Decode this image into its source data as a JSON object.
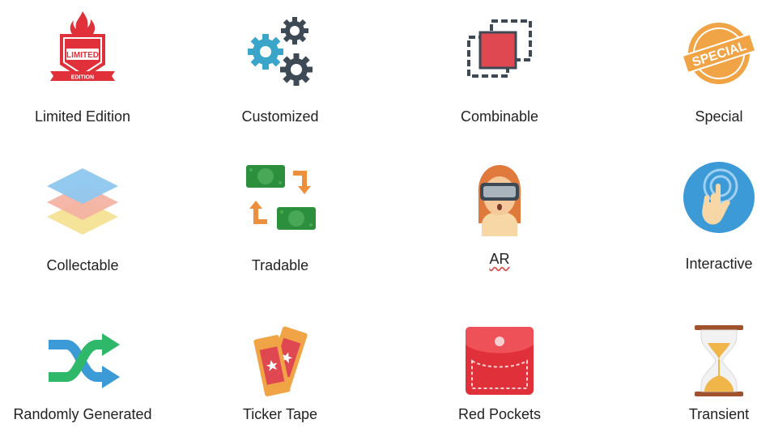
{
  "items": [
    {
      "label": "Limited Edition",
      "icon": "limited-edition-badge-icon"
    },
    {
      "label": "Customized",
      "icon": "gears-icon"
    },
    {
      "label": "Combinable",
      "icon": "combine-squares-icon"
    },
    {
      "label": "Special",
      "icon": "special-stamp-icon"
    },
    {
      "label": "Collectable",
      "icon": "stacked-layers-icon"
    },
    {
      "label": "Tradable",
      "icon": "exchange-cash-icon"
    },
    {
      "label": "AR",
      "icon": "vr-headset-person-icon"
    },
    {
      "label": "Interactive",
      "icon": "touch-hand-icon"
    },
    {
      "label": "Randomly Generated",
      "icon": "shuffle-icon"
    },
    {
      "label": "Ticker Tape",
      "icon": "tickets-icon"
    },
    {
      "label": "Red Pockets",
      "icon": "red-envelope-icon"
    },
    {
      "label": "Transient",
      "icon": "hourglass-icon"
    }
  ],
  "badge_text": {
    "limited": "LIMITED",
    "edition": "EDITION",
    "special": "SPECIAL"
  },
  "colors": {
    "red": "#e0303a",
    "teal": "#3aa4c9",
    "dark_gray": "#3d4a55",
    "orange": "#f0a445",
    "blue": "#3c9ad6",
    "green": "#2c8f3c"
  }
}
